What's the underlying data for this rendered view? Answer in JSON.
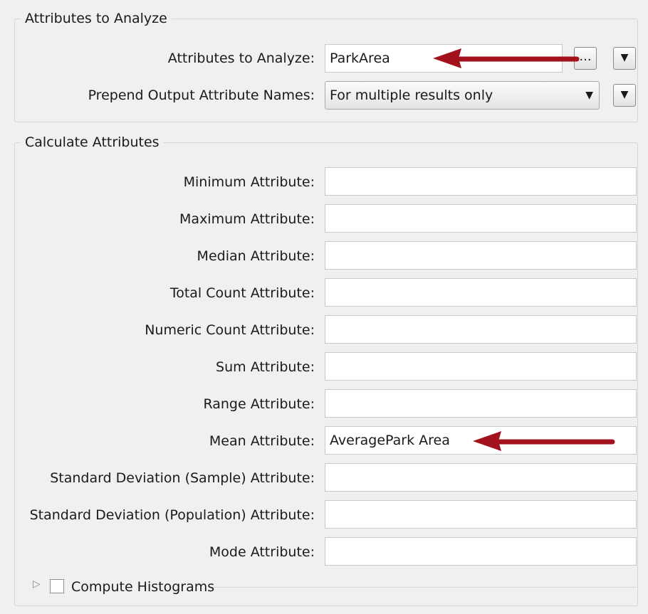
{
  "group_analyze": {
    "title": "Attributes to Analyze",
    "attributes_label": "Attributes to Analyze:",
    "attributes_value": "ParkArea",
    "ellipsis_label": "...",
    "prepend_label": "Prepend Output Attribute Names:",
    "prepend_value": "For multiple results only"
  },
  "group_calculate": {
    "title": "Calculate Attributes",
    "rows": [
      {
        "label": "Minimum Attribute:",
        "value": ""
      },
      {
        "label": "Maximum Attribute:",
        "value": ""
      },
      {
        "label": "Median Attribute:",
        "value": ""
      },
      {
        "label": "Total Count Attribute:",
        "value": ""
      },
      {
        "label": "Numeric Count Attribute:",
        "value": ""
      },
      {
        "label": "Sum Attribute:",
        "value": ""
      },
      {
        "label": "Range Attribute:",
        "value": ""
      },
      {
        "label": "Mean Attribute:",
        "value": "AveragePark Area"
      },
      {
        "label": "Standard Deviation (Sample) Attribute:",
        "value": ""
      },
      {
        "label": "Standard Deviation (Population) Attribute:",
        "value": ""
      },
      {
        "label": "Mode Attribute:",
        "value": ""
      }
    ],
    "histogram_label": "Compute Histograms"
  },
  "colors": {
    "annotation_arrow": "#a3121c"
  }
}
